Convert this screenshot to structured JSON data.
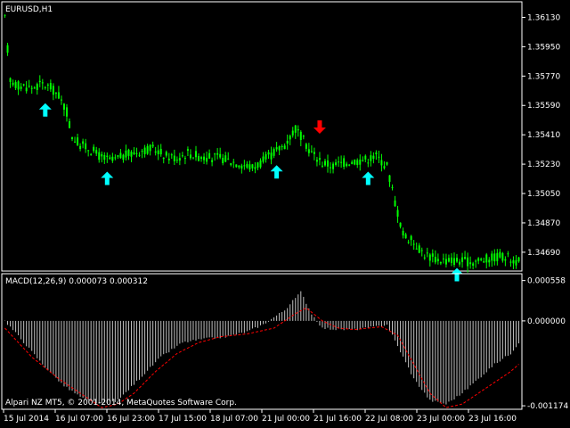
{
  "chart": {
    "symbol_title": "EURUSD,H1",
    "indicator_title": "MACD(12,26,9) 0.000073 0.000312",
    "footer": "Alpari NZ MT5, © 2001-2014, MetaQuotes Software Corp.",
    "colors": {
      "background": "#000000",
      "frame": "#ffffff",
      "candle": "#00ff00",
      "histogram": "#c0c0c0",
      "signal": "#ff0000",
      "arrow_up": "#00ffff",
      "arrow_down": "#ff0000"
    },
    "price_ticks": [
      "1.36130",
      "1.35950",
      "1.35770",
      "1.35590",
      "1.35410",
      "1.35230",
      "1.35050",
      "1.34870",
      "1.34690"
    ],
    "macd_ticks": [
      "0.000558",
      "0.000000",
      "-0.001174"
    ],
    "time_labels": [
      "15 Jul 2014",
      "16 Jul 07:00",
      "16 Jul 23:00",
      "17 Jul 15:00",
      "18 Jul 07:00",
      "21 Jul 00:00",
      "21 Jul 16:00",
      "22 Jul 08:00",
      "23 Jul 00:00",
      "23 Jul 16:00"
    ]
  },
  "chart_data": {
    "type": "candlestick",
    "price_ylim": [
      1.3458,
      1.3622
    ],
    "macd_ylim": [
      -0.00121,
      0.00064
    ],
    "price_path": [
      [
        0,
        1.3612
      ],
      [
        2,
        1.3575
      ],
      [
        4,
        1.3572
      ],
      [
        6,
        1.3571
      ],
      [
        10,
        1.357
      ],
      [
        14,
        1.3572
      ],
      [
        17,
        1.357
      ],
      [
        20,
        1.3565
      ],
      [
        23,
        1.3555
      ],
      [
        25,
        1.354
      ],
      [
        28,
        1.3535
      ],
      [
        32,
        1.3532
      ],
      [
        36,
        1.3527
      ],
      [
        40,
        1.3525
      ],
      [
        44,
        1.3528
      ],
      [
        48,
        1.353
      ],
      [
        52,
        1.3532
      ],
      [
        56,
        1.3532
      ],
      [
        60,
        1.3528
      ],
      [
        64,
        1.3527
      ],
      [
        68,
        1.353
      ],
      [
        72,
        1.3528
      ],
      [
        76,
        1.3527
      ],
      [
        80,
        1.3527
      ],
      [
        84,
        1.3525
      ],
      [
        88,
        1.3523
      ],
      [
        92,
        1.3521
      ],
      [
        96,
        1.3525
      ],
      [
        100,
        1.353
      ],
      [
        104,
        1.3535
      ],
      [
        108,
        1.3545
      ],
      [
        110,
        1.354
      ],
      [
        114,
        1.353
      ],
      [
        118,
        1.3524
      ],
      [
        122,
        1.3522
      ],
      [
        126,
        1.3524
      ],
      [
        130,
        1.3525
      ],
      [
        134,
        1.3526
      ],
      [
        138,
        1.3528
      ],
      [
        142,
        1.3522
      ],
      [
        145,
        1.35
      ],
      [
        148,
        1.348
      ],
      [
        152,
        1.3475
      ],
      [
        156,
        1.3468
      ],
      [
        160,
        1.3465
      ],
      [
        164,
        1.3464
      ],
      [
        168,
        1.3464
      ],
      [
        172,
        1.3463
      ],
      [
        176,
        1.3464
      ],
      [
        180,
        1.3465
      ],
      [
        184,
        1.3467
      ],
      [
        188,
        1.3465
      ],
      [
        191,
        1.3463
      ]
    ],
    "macd_path": [
      [
        0,
        0.0
      ],
      [
        6,
        -0.00025
      ],
      [
        14,
        -0.0006
      ],
      [
        22,
        -0.0009
      ],
      [
        30,
        -0.0011
      ],
      [
        36,
        -0.00115
      ],
      [
        42,
        -0.0011
      ],
      [
        50,
        -0.0008
      ],
      [
        58,
        -0.0005
      ],
      [
        66,
        -0.0003
      ],
      [
        74,
        -0.00025
      ],
      [
        82,
        -0.00022
      ],
      [
        90,
        -0.00015
      ],
      [
        96,
        -5e-05
      ],
      [
        104,
        0.00015
      ],
      [
        110,
        0.0004
      ],
      [
        114,
        0.0001
      ],
      [
        118,
        -0.0001
      ],
      [
        124,
        -0.00012
      ],
      [
        130,
        -0.00012
      ],
      [
        138,
        -8e-05
      ],
      [
        142,
        -5e-05
      ],
      [
        146,
        -0.00035
      ],
      [
        152,
        -0.0008
      ],
      [
        158,
        -0.0011
      ],
      [
        164,
        -0.00115
      ],
      [
        170,
        -0.001
      ],
      [
        176,
        -0.0008
      ],
      [
        182,
        -0.0006
      ],
      [
        188,
        -0.00045
      ],
      [
        191,
        -0.0003
      ]
    ],
    "signal_path": [
      [
        0,
        -0.0001
      ],
      [
        10,
        -0.0005
      ],
      [
        20,
        -0.0008
      ],
      [
        30,
        -0.00105
      ],
      [
        36,
        -0.0012
      ],
      [
        42,
        -0.00115
      ],
      [
        48,
        -0.001
      ],
      [
        56,
        -0.0007
      ],
      [
        64,
        -0.00045
      ],
      [
        72,
        -0.0003
      ],
      [
        80,
        -0.00022
      ],
      [
        90,
        -0.00018
      ],
      [
        100,
        -0.0001
      ],
      [
        108,
        0.0001
      ],
      [
        112,
        0.00018
      ],
      [
        118,
        0.0
      ],
      [
        124,
        -0.0001
      ],
      [
        130,
        -0.00012
      ],
      [
        140,
        -8e-05
      ],
      [
        146,
        -0.0002
      ],
      [
        152,
        -0.0006
      ],
      [
        158,
        -0.001
      ],
      [
        164,
        -0.0012
      ],
      [
        170,
        -0.00115
      ],
      [
        176,
        -0.001
      ],
      [
        182,
        -0.00085
      ],
      [
        188,
        -0.0007
      ],
      [
        191,
        -0.0006
      ]
    ],
    "signals": [
      {
        "type": "up",
        "bar": 15,
        "price": 1.3556
      },
      {
        "type": "up",
        "bar": 38,
        "price": 1.3514
      },
      {
        "type": "up",
        "bar": 101,
        "price": 1.3518
      },
      {
        "type": "down",
        "bar": 117,
        "price": 1.3546
      },
      {
        "type": "up",
        "bar": 135,
        "price": 1.3514
      },
      {
        "type": "up",
        "bar": 168,
        "price": 1.3455
      }
    ]
  }
}
